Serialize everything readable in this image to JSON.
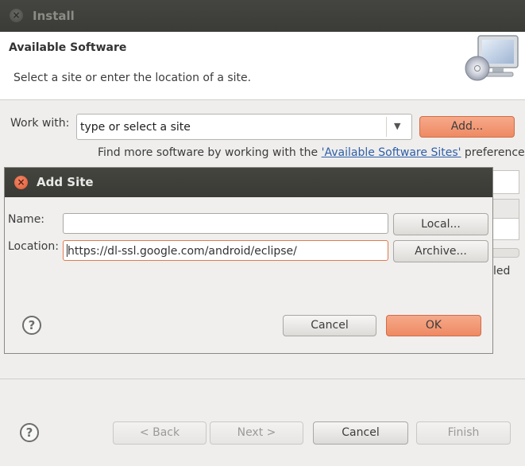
{
  "install": {
    "title": "Install",
    "header_title": "Available Software",
    "header_description": "Select a site or enter the location of a site.",
    "work_with_label": "Work with:",
    "work_with_value": "type or select a site",
    "add_button": "Add...",
    "find_more_prefix": "Find more software by working with the ",
    "find_more_link": "'Available Software Sites'",
    "find_more_suffix": " preferences.",
    "bg_partial_text": "led",
    "buttons": {
      "back": "< Back",
      "next": "Next >",
      "cancel": "Cancel",
      "finish": "Finish"
    }
  },
  "add_site": {
    "title": "Add Site",
    "name_label": "Name:",
    "name_value": "",
    "location_label": "Location:",
    "location_value": "https://dl-ssl.google.com/android/eclipse/",
    "local_button": "Local...",
    "archive_button": "Archive...",
    "cancel_button": "Cancel",
    "ok_button": "OK"
  },
  "icons": {
    "help": "?",
    "close": "×",
    "dropdown": "▼"
  },
  "colors": {
    "accent": "#ee8a63",
    "title_bar": "#3c3b37",
    "link": "#2e5fa8"
  }
}
